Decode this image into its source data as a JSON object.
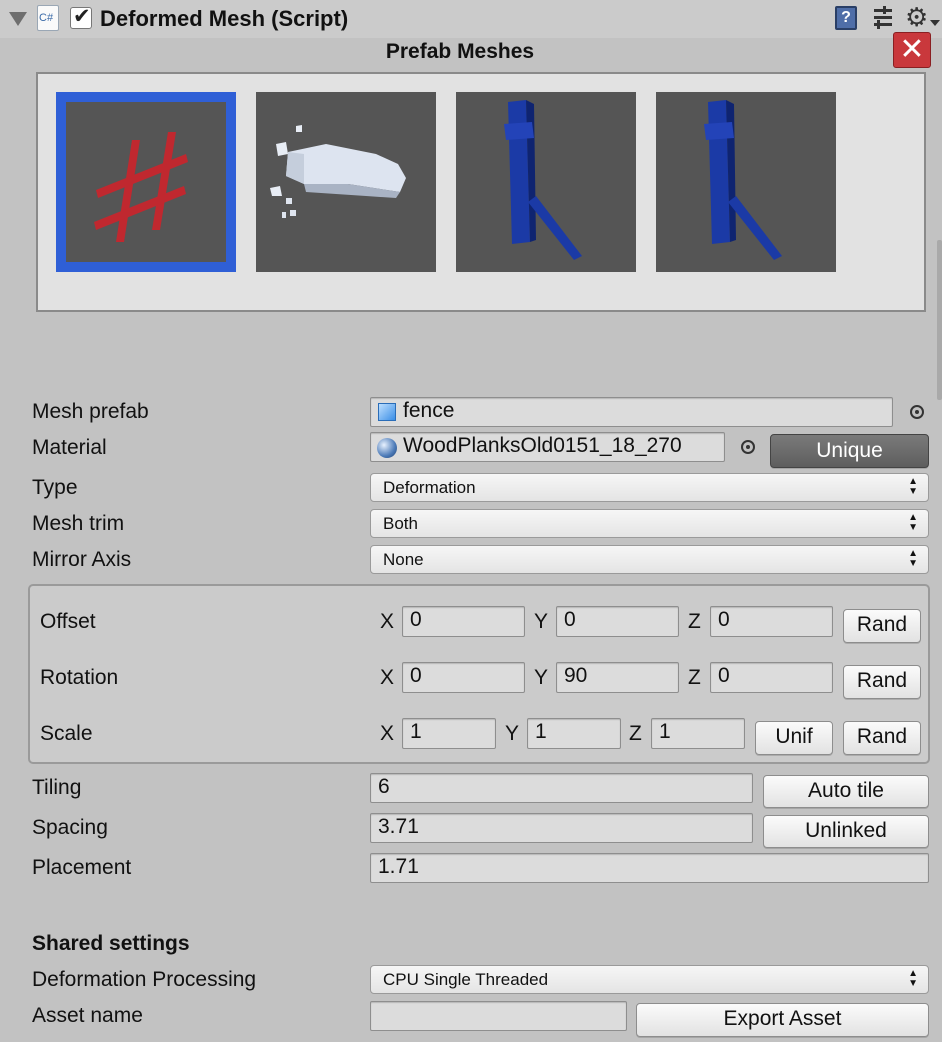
{
  "header": {
    "title": "Deformed Mesh (Script)",
    "script_badge": "C#",
    "enabled": true
  },
  "prefab_meshes": {
    "title": "Prefab Meshes",
    "thumbnails": [
      "fence-mesh",
      "rock-block-mesh",
      "blue-post-mesh",
      "blue-post-mesh"
    ],
    "selected_index": 0
  },
  "properties": {
    "mesh_prefab": {
      "label": "Mesh prefab",
      "value": "fence"
    },
    "material": {
      "label": "Material",
      "value": "WoodPlanksOld0151_18_270",
      "unique_label": "Unique"
    },
    "type": {
      "label": "Type",
      "value": "Deformation"
    },
    "mesh_trim": {
      "label": "Mesh trim",
      "value": "Both"
    },
    "mirror_axis": {
      "label": "Mirror Axis",
      "value": "None"
    }
  },
  "transform": {
    "offset": {
      "label": "Offset",
      "x": "0",
      "y": "0",
      "z": "0",
      "rand_label": "Rand"
    },
    "rotation": {
      "label": "Rotation",
      "x": "0",
      "y": "90",
      "z": "0",
      "rand_label": "Rand"
    },
    "scale": {
      "label": "Scale",
      "x": "1",
      "y": "1",
      "z": "1",
      "unif_label": "Unif",
      "rand_label": "Rand"
    },
    "axis_x": "X",
    "axis_y": "Y",
    "axis_z": "Z"
  },
  "tiling": {
    "label": "Tiling",
    "value": "6",
    "button": "Auto tile"
  },
  "spacing": {
    "label": "Spacing",
    "value": "3.71",
    "button": "Unlinked"
  },
  "placement": {
    "label": "Placement",
    "value": "1.71"
  },
  "shared": {
    "heading": "Shared settings",
    "deformation_processing": {
      "label": "Deformation Processing",
      "value": "CPU Single Threaded"
    },
    "asset_name": {
      "label": "Asset name",
      "value": "",
      "button": "Export Asset"
    }
  },
  "colors": {
    "selection_blue": "#2f5fd6",
    "fence_red": "#c0282f",
    "post_blue": "#1b3aa6",
    "close_red": "#c9383c"
  }
}
